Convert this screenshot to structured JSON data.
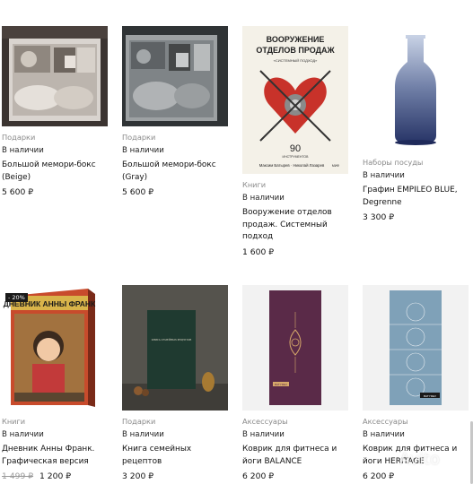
{
  "products": [
    {
      "category": "Подарки",
      "stock": "В наличии",
      "title": "Большой мемори-бокс (Beige)",
      "price": "5 600 ₽",
      "old_price": "",
      "badge": ""
    },
    {
      "category": "Подарки",
      "stock": "В наличии",
      "title": "Большой мемори-бокс (Gray)",
      "price": "5 600 ₽",
      "old_price": "",
      "badge": ""
    },
    {
      "category": "Книги",
      "stock": "В наличии",
      "title": "Вооружение отделов продаж. Системный подход",
      "price": "1 600 ₽",
      "old_price": "",
      "badge": ""
    },
    {
      "category": "Наборы посуды",
      "stock": "В наличии",
      "title": "Графин EMPILEO BLUE, Degrenne",
      "price": "3 300 ₽",
      "old_price": "",
      "badge": ""
    },
    {
      "category": "Книги",
      "stock": "В наличии",
      "title": "Дневник Анны Франк. Графическая версия",
      "price": "1 200 ₽",
      "old_price": "1 499 ₽",
      "badge": "- 20%"
    },
    {
      "category": "Подарки",
      "stock": "В наличии",
      "title": "Книга семейных рецептов",
      "price": "3 200 ₽",
      "old_price": "",
      "badge": ""
    },
    {
      "category": "Аксессуары",
      "stock": "В наличии",
      "title": "Коврик для фитнеса и йоги BALANCE",
      "price": "6 200 ₽",
      "old_price": "",
      "badge": ""
    },
    {
      "category": "Аксессуары",
      "stock": "В наличии",
      "title": "Коврик для фитнеса и йоги HERITAGE",
      "price": "6 200 ₽",
      "old_price": "",
      "badge": ""
    }
  ],
  "book_cover": {
    "title_line1": "ВООРУЖЕНИЕ",
    "title_line2": "ОТДЕЛОВ ПРОДАЖ",
    "subtitle": "«СИСТЕМНЫЙ ПОДХОД»",
    "number": "90",
    "number_caption": "ИНСТРУМЕНТОВ",
    "authors": "Максим Батырев · Николай Лазарев",
    "publisher": "МИФ"
  },
  "diary_cover": {
    "title": "ДНЕВНИК АННЫ ФРАНК"
  },
  "recipe_cover": {
    "title": "КНИГА СЕМЕЙНЫХ РЕЦЕПТОВ"
  },
  "mat_label": "BATYREV",
  "watermark": "Avito",
  "colors": {
    "accent": "#1c1c1c",
    "muted": "#8a8a8a",
    "badge_bg": "#1a1a1a"
  }
}
